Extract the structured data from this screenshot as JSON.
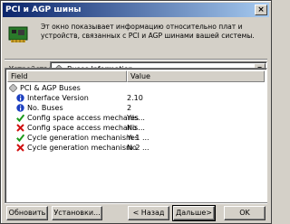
{
  "window": {
    "title": "PCI и AGP шины",
    "close_glyph": "×"
  },
  "intro": {
    "text": "Эт окно показывает информацию относительно плат и устройств, связанных с PCI и AGP шинами вашей системы.",
    "icon": "pci-card-icon"
  },
  "device": {
    "label_prefix": "У",
    "label_rest": "стройство:",
    "selected": "Buses Information",
    "icon": "diamond-icon",
    "dropdown_glyph": "▼"
  },
  "grid": {
    "columns": [
      "Field",
      "Value"
    ],
    "rows": [
      {
        "field": "PCI & AGP Buses",
        "value": "",
        "icon": "diamond-icon",
        "indent": 0
      },
      {
        "field": "Interface Version",
        "value": "2.10",
        "icon": "info-icon",
        "indent": 1
      },
      {
        "field": "No. Buses",
        "value": "2",
        "icon": "info-icon",
        "indent": 1
      },
      {
        "field": "Config space access mechanis...",
        "value": "Yes",
        "icon": "check-icon",
        "indent": 1
      },
      {
        "field": "Config space access mechanis...",
        "value": "No",
        "icon": "cross-icon",
        "indent": 1
      },
      {
        "field": "Cycle generation mechanism 1 ...",
        "value": "Yes",
        "icon": "check-icon",
        "indent": 1
      },
      {
        "field": "Cycle generation mechanism 2 ...",
        "value": "No",
        "icon": "cross-icon",
        "indent": 1
      }
    ]
  },
  "buttons": {
    "refresh": "Обновить",
    "settings": "Установки...",
    "back": "< Назад",
    "next": "Дальше>",
    "ok": "OK"
  },
  "colors": {
    "title_start": "#0a246a",
    "title_end": "#a6caf0",
    "info": "#1c3fc0",
    "check": "#1a9a1a",
    "cross": "#d01010",
    "diamond": "#9a9a9a"
  }
}
